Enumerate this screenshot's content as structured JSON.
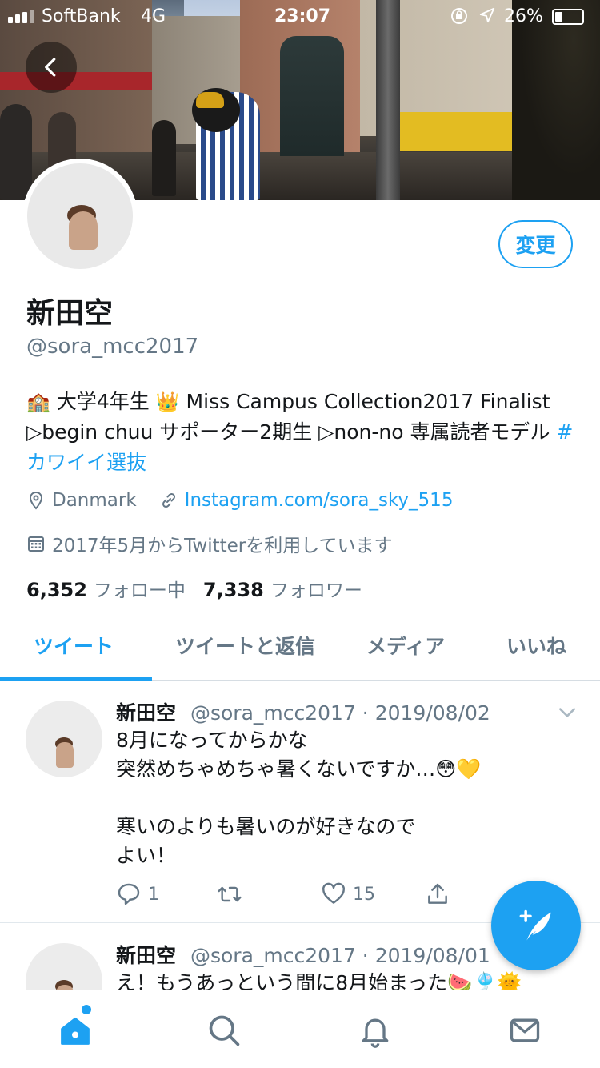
{
  "status_bar": {
    "carrier": "SoftBank",
    "network": "4G",
    "time": "23:07",
    "battery": "26%"
  },
  "profile": {
    "name": "新田空",
    "handle": "@sora_mcc2017",
    "edit_label": "変更",
    "bio_part1": "大学4年生",
    "bio_part2": "Miss Campus Collection2017 Finalist ▷begin chuu サポーター2期生 ▷non-no 専属読者モデル",
    "bio_hashtag": "#カワイイ選抜",
    "location": "Danmark",
    "website": "Instagram.com/sora_sky_515",
    "joined": "2017年5月からTwitterを利用しています",
    "following_count": "6,352",
    "following_label": "フォロー中",
    "followers_count": "7,338",
    "followers_label": "フォロワー"
  },
  "tabs": [
    {
      "label": "ツイート"
    },
    {
      "label": "ツイートと返信"
    },
    {
      "label": "メディア"
    },
    {
      "label": "いいね"
    }
  ],
  "tweets": [
    {
      "name": "新田空",
      "meta": "@sora_mcc2017 · 2019/08/02",
      "text": "8月になってからかな\n突然めちゃめちゃ暑くないですか…😳💛\n\n寒いのよりも暑いのが好きなので\nよい！",
      "replies": "1",
      "likes": "15"
    },
    {
      "name": "新田空",
      "meta": "@sora_mcc2017 · 2019/08/01",
      "text": "え！もうあっという間に8月始まった🍉🎐🌞"
    }
  ],
  "colors": {
    "accent": "#1da1f2",
    "secondary_text": "#657786"
  }
}
